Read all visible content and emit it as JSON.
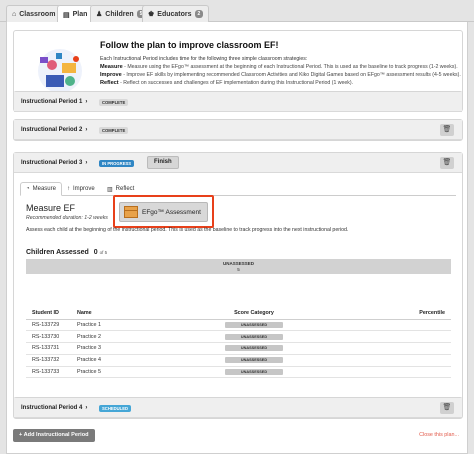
{
  "tabs": [
    {
      "label": "Classroom",
      "icon": "home-icon"
    },
    {
      "label": "Plan",
      "icon": "clipboard-icon"
    },
    {
      "label": "Children",
      "icon": "child-icon",
      "count": "5"
    },
    {
      "label": "Educators",
      "icon": "people-icon",
      "count": "2"
    }
  ],
  "intro": {
    "title": "Follow the plan to improve classroom EF!",
    "lead": "Each Instructional Period includes time for the following three simple classroom strategies:",
    "measure_term": "Measure",
    "measure_text": " - Measure using the EFgo™ assessment at the beginning of each Instructional Period. This is used as the baseline to track progress (1-2 weeks).",
    "improve_term": "Improve",
    "improve_text": " - Improve EF skills by implementing recommended Classroom Activities and Kiko Digital Games based on EFgo™ assessment results (4-5 weeks).",
    "reflect_term": "Reflect",
    "reflect_text": " - Reflect on successes and challenges of EF implementation during this Instructional Period (1 week)."
  },
  "periods": [
    {
      "title": "Instructional Period 1",
      "badge": "COMPLETE"
    },
    {
      "title": "Instructional Period 2",
      "badge": "COMPLETE"
    },
    {
      "title": "Instructional Period 3",
      "badge": "IN PROGRESS",
      "finish": "Finish"
    },
    {
      "title": "Instructional Period 4",
      "badge": "SCHEDULED"
    }
  ],
  "inner_tabs": [
    {
      "label": "Measure",
      "icon": "gauge-icon"
    },
    {
      "label": "Improve",
      "icon": "arrow-up-icon"
    },
    {
      "label": "Reflect",
      "icon": "chart-icon"
    }
  ],
  "measure": {
    "title": "Measure EF",
    "duration": "Recommended duration: 1-2 weeks",
    "assessment_button": "EFgo™ Assessment",
    "description": "Assess each child at the beginning of the instructional period. This is used as the baseline to track progress into the next instructional period."
  },
  "children_assessed": {
    "label": "Children Assessed",
    "count": "0",
    "of_total": "of 5",
    "bar_label": "UNASSESSED",
    "bar_value": "5"
  },
  "roster": {
    "columns": [
      "Student ID",
      "Name",
      "Score Category",
      "Percentile"
    ],
    "rows": [
      {
        "id": "RS-133729",
        "name": "Practice 1",
        "category": "UNASSESSED",
        "percentile": ""
      },
      {
        "id": "RS-133730",
        "name": "Practice 2",
        "category": "UNASSESSED",
        "percentile": ""
      },
      {
        "id": "RS-133731",
        "name": "Practice 3",
        "category": "UNASSESSED",
        "percentile": ""
      },
      {
        "id": "RS-133732",
        "name": "Practice 4",
        "category": "UNASSESSED",
        "percentile": ""
      },
      {
        "id": "RS-133733",
        "name": "Practice 5",
        "category": "UNASSESSED",
        "percentile": ""
      }
    ]
  },
  "footer": {
    "add_label": "+ Add Instructional Period",
    "close_label": "Close this plan..."
  },
  "colors": {
    "highlight": "#e8401a",
    "in_progress": "#2f86c4",
    "scheduled": "#45a6d6",
    "close_link": "#e25a4a"
  }
}
